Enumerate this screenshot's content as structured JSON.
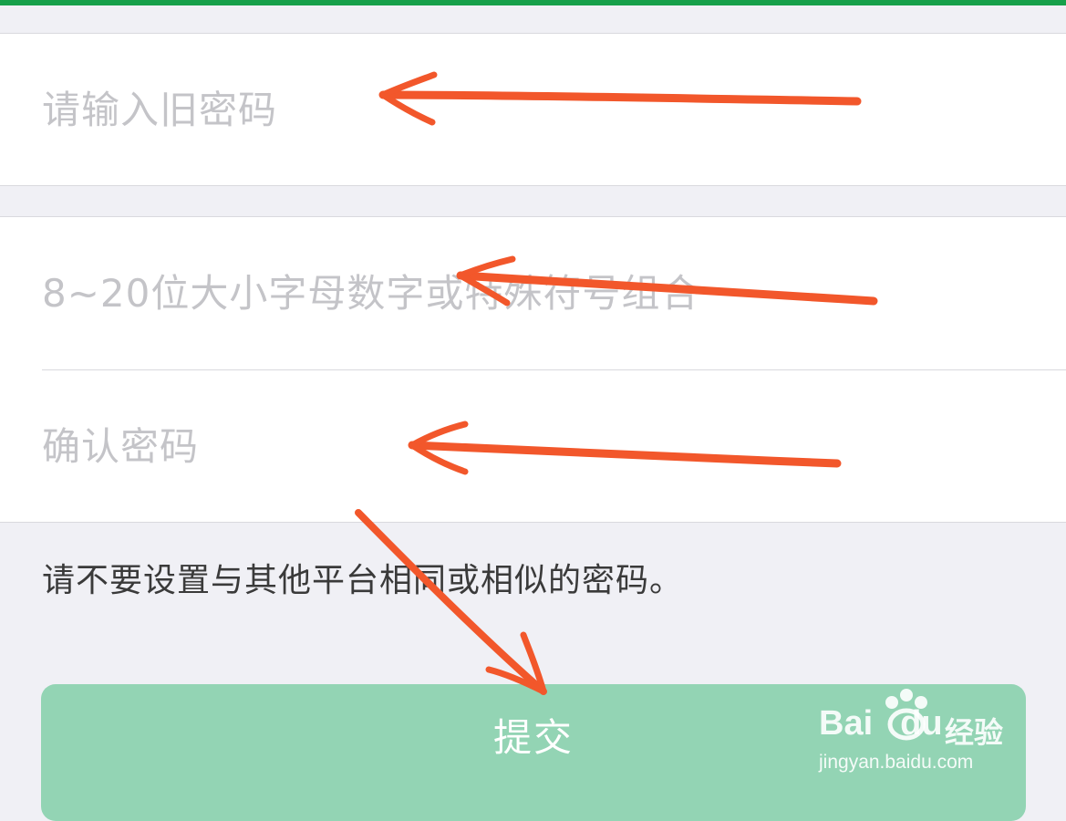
{
  "form": {
    "old_password": {
      "placeholder": "请输入旧密码",
      "value": ""
    },
    "new_password": {
      "placeholder": "8~20位大小字母数字或特殊符号组合",
      "value": ""
    },
    "confirm_password": {
      "placeholder": "确认密码",
      "value": ""
    },
    "hint": "请不要设置与其他平台相同或相似的密码。",
    "submit_label": "提交"
  },
  "watermark": {
    "brand": "Bai",
    "brand_suffix": "du",
    "cn": "经验",
    "url": "jingyan.baidu.com"
  },
  "colors": {
    "accent_bar": "#17a04a",
    "submit_bg": "#93d4b4",
    "annotation_arrow": "#f2572b",
    "page_bg": "#f0f0f5"
  }
}
